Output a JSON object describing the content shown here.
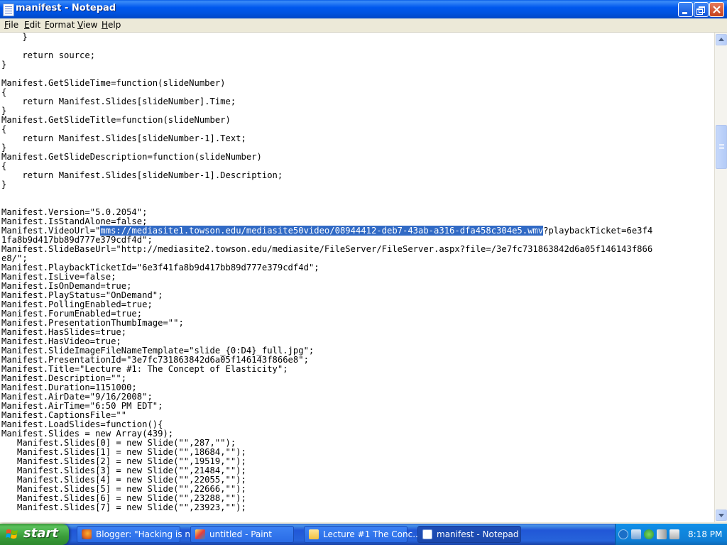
{
  "window": {
    "title": "manifest - Notepad"
  },
  "menu": {
    "file": "File",
    "edit": "Edit",
    "format": "Format",
    "view": "View",
    "help": "Help"
  },
  "editor": {
    "before_selection": "    }\n\n    return source;\n}\n\nManifest.GetSlideTime=function(slideNumber)\n{\n    return Manifest.Slides[slideNumber].Time;\n}\nManifest.GetSlideTitle=function(slideNumber)\n{\n    return Manifest.Slides[slideNumber-1].Text;\n}\nManifest.GetSlideDescription=function(slideNumber)\n{\n    return Manifest.Slides[slideNumber-1].Description;\n}\n\n\nManifest.Version=\"5.0.2054\";\nManifest.IsStandAlone=false;\nManifest.VideoUrl=\"",
    "selected_text": "mms://mediasite1.towson.edu/mediasite50video/08944412-deb7-43ab-a316-dfa458c304e5.wmv",
    "after_selection": "?playbackTicket=6e3f4\n1fa8b9d417bb89d777e379cdf4d\";\nManifest.SlideBaseUrl=\"http://mediasite2.towson.edu/mediasite/FileServer/FileServer.aspx?file=/3e7fc731863842d6a05f146143f866\ne8/\";\nManifest.PlaybackTicketId=\"6e3f41fa8b9d417bb89d777e379cdf4d\";\nManifest.IsLive=false;\nManifest.IsOnDemand=true;\nManifest.PlayStatus=\"OnDemand\";\nManifest.PollingEnabled=true;\nManifest.ForumEnabled=true;\nManifest.PresentationThumbImage=\"\";\nManifest.HasSlides=true;\nManifest.HasVideo=true;\nManifest.SlideImageFileNameTemplate=\"slide_{0:D4}_full.jpg\";\nManifest.PresentationId=\"3e7fc731863842d6a05f146143f866e8\";\nManifest.Title=\"Lecture #1: The Concept of Elasticity\";\nManifest.Description=\"\";\nManifest.Duration=1151000;\nManifest.AirDate=\"9/16/2008\";\nManifest.AirTime=\"6:50 PM EDT\";\nManifest.CaptionsFile=\"\"\nManifest.LoadSlides=function(){\nManifest.Slides = new Array(439);\n   Manifest.Slides[0] = new Slide(\"\",287,\"\");\n   Manifest.Slides[1] = new Slide(\"\",18684,\"\");\n   Manifest.Slides[2] = new Slide(\"\",19519,\"\");\n   Manifest.Slides[3] = new Slide(\"\",21484,\"\");\n   Manifest.Slides[4] = new Slide(\"\",22055,\"\");\n   Manifest.Slides[5] = new Slide(\"\",22666,\"\");\n   Manifest.Slides[6] = new Slide(\"\",23288,\"\");\n   Manifest.Slides[7] = new Slide(\"\",23923,\"\");"
  },
  "taskbar": {
    "start_label": "start",
    "tasks": [
      {
        "label": "Blogger: \"Hacking is n...",
        "icon": "firefox-icon"
      },
      {
        "label": "untitled - Paint",
        "icon": "paint-icon"
      },
      {
        "label": "Lecture #1 The Conc...",
        "icon": "folder-icon"
      },
      {
        "label": "manifest - Notepad",
        "icon": "notepad-icon"
      }
    ],
    "clock": "8:18 PM"
  },
  "colors": {
    "selection": "#316ac5",
    "titlebar": "#0058ee",
    "start_button": "#3a9c3a"
  }
}
